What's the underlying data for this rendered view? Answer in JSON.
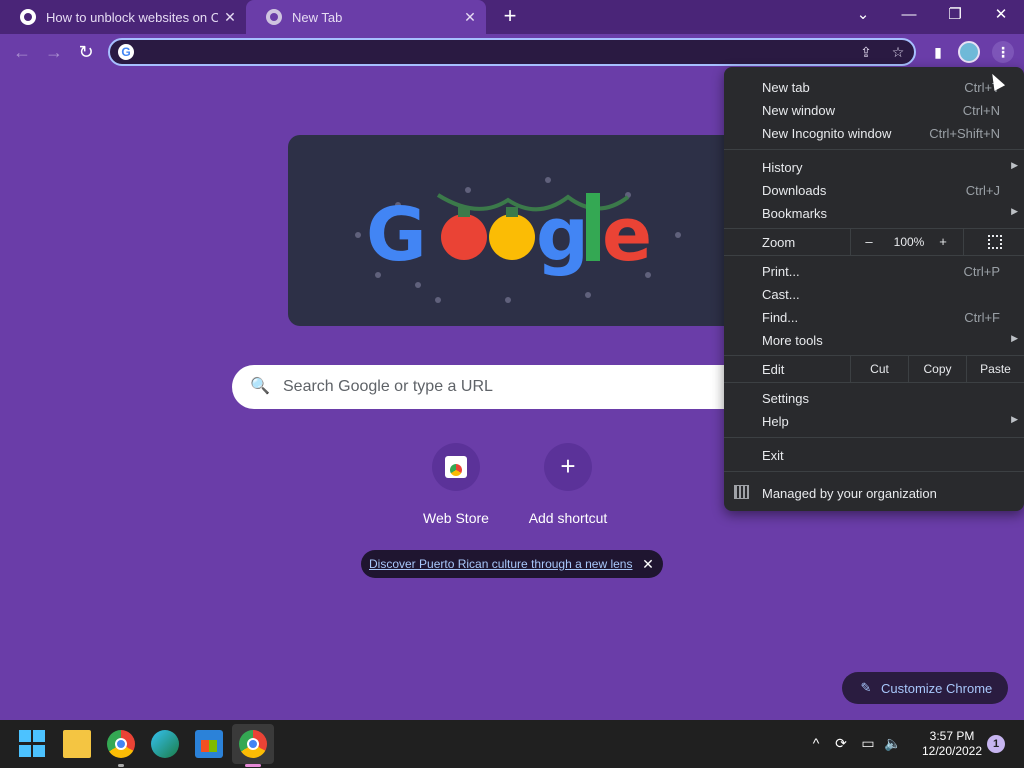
{
  "tabs": [
    {
      "title": "How to unblock websites on Chrome",
      "active": false
    },
    {
      "title": "New Tab",
      "active": true
    }
  ],
  "toolbar": {
    "url": ""
  },
  "search": {
    "placeholder": "Search Google or type a URL"
  },
  "shortcuts": [
    {
      "label": "Web Store"
    },
    {
      "label": "Add shortcut"
    }
  ],
  "promo": {
    "link_text": "Discover Puerto Rican culture through a new lens"
  },
  "customize": {
    "label": "Customize Chrome"
  },
  "menu": {
    "new_tab": {
      "label": "New tab",
      "shortcut": "Ctrl+T"
    },
    "new_window": {
      "label": "New window",
      "shortcut": "Ctrl+N"
    },
    "new_incognito": {
      "label": "New Incognito window",
      "shortcut": "Ctrl+Shift+N"
    },
    "history": {
      "label": "History"
    },
    "downloads": {
      "label": "Downloads",
      "shortcut": "Ctrl+J"
    },
    "bookmarks": {
      "label": "Bookmarks"
    },
    "zoom": {
      "label": "Zoom",
      "minus": "–",
      "value": "100%",
      "plus": "+"
    },
    "print": {
      "label": "Print...",
      "shortcut": "Ctrl+P"
    },
    "cast": {
      "label": "Cast..."
    },
    "find": {
      "label": "Find...",
      "shortcut": "Ctrl+F"
    },
    "more_tools": {
      "label": "More tools"
    },
    "edit": {
      "label": "Edit",
      "cut": "Cut",
      "copy": "Copy",
      "paste": "Paste"
    },
    "settings": {
      "label": "Settings"
    },
    "help": {
      "label": "Help"
    },
    "exit": {
      "label": "Exit"
    },
    "managed": {
      "label": "Managed by your organization"
    }
  },
  "taskbar": {
    "time": "3:57 PM",
    "date": "12/20/2022",
    "notification_count": "1"
  },
  "colors": {
    "page_background": "#6a3da8",
    "tabstrip": "#4a2578",
    "menu_background": "#292a2d",
    "accent_link": "#a8c7fa"
  }
}
